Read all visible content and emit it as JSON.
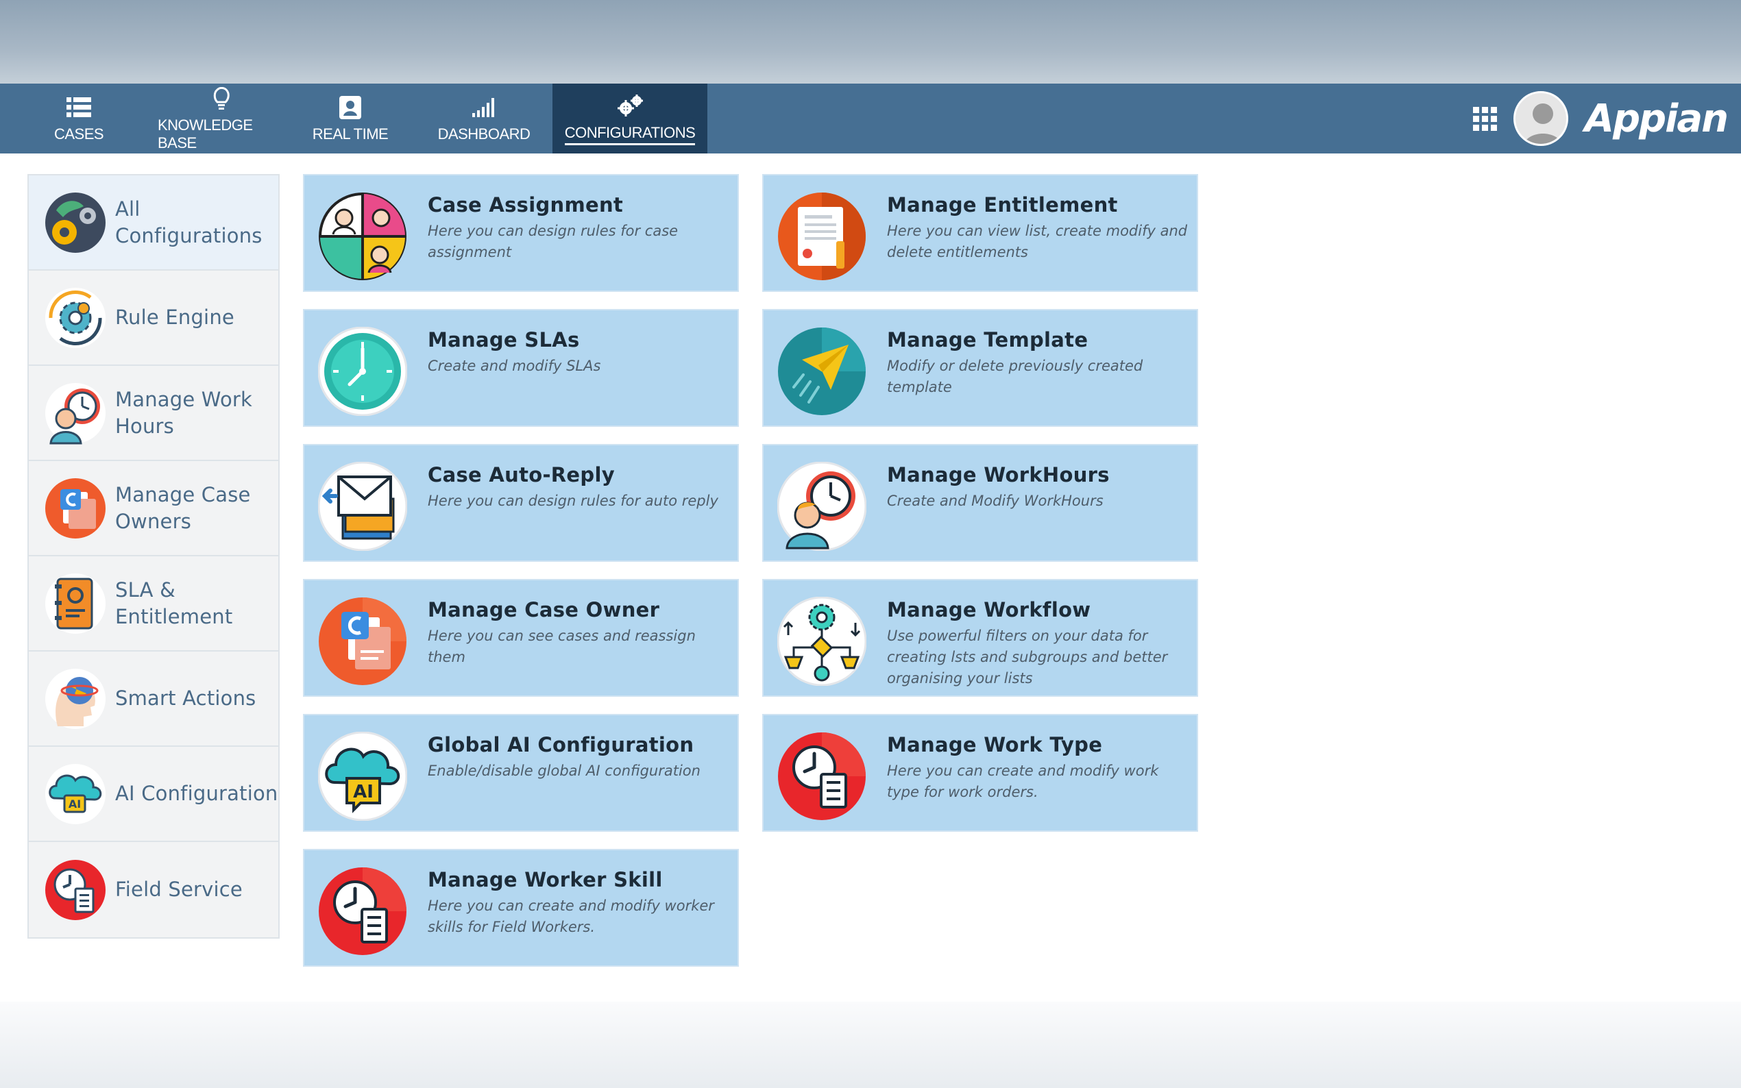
{
  "nav": {
    "tabs": [
      {
        "label": "CASES",
        "icon": "list-icon"
      },
      {
        "label": "KNOWLEDGE BASE",
        "icon": "lightbulb-icon"
      },
      {
        "label": "REAL TIME",
        "icon": "contact-card-icon"
      },
      {
        "label": "DASHBOARD",
        "icon": "signal-bars-icon"
      },
      {
        "label": "CONFIGURATIONS",
        "icon": "gears-icon",
        "active": true
      }
    ],
    "brand": "Appian",
    "accent_color": "#466f93",
    "active_tab_color": "#1f3f5d"
  },
  "sidebar": {
    "items": [
      {
        "label": "All Configurations",
        "icon": "gears-globe-icon"
      },
      {
        "label": "Rule Engine",
        "icon": "gear-cycle-icon"
      },
      {
        "label": "Manage Work Hours",
        "icon": "person-clock-icon"
      },
      {
        "label": "Manage Case Owners",
        "icon": "case-document-icon"
      },
      {
        "label": "SLA & Entitlement",
        "icon": "contact-book-icon"
      },
      {
        "label": "Smart Actions",
        "icon": "head-globe-icon"
      },
      {
        "label": "AI Configuration",
        "icon": "ai-cloud-icon"
      },
      {
        "label": "Field Service",
        "icon": "clock-checklist-icon"
      }
    ]
  },
  "cards": [
    {
      "title": "Case Assignment",
      "desc": "Here you can design rules for case assignment",
      "icon": "people-assignment-icon"
    },
    {
      "title": "Manage Entitlement",
      "desc": "Here you can view list, create modify and delete entitlements",
      "icon": "certificate-document-icon"
    },
    {
      "title": "Manage SLAs",
      "desc": "Create and modify SLAs",
      "icon": "clock-icon"
    },
    {
      "title": "Manage Template",
      "desc": "Modify or delete previously created template",
      "icon": "paper-plane-icon"
    },
    {
      "title": "Case Auto-Reply",
      "desc": "Here you can design rules for auto reply",
      "icon": "envelope-reply-icon"
    },
    {
      "title": "Manage WorkHours",
      "desc": "Create and Modify WorkHours",
      "icon": "person-clock-icon"
    },
    {
      "title": "Manage Case Owner",
      "desc": "Here you can see cases and reassign them",
      "icon": "case-document-icon"
    },
    {
      "title": "Manage Workflow",
      "desc": "Use powerful filters on your data for creating lsts and subgroups and better organising your lists",
      "icon": "workflow-gear-icon"
    },
    {
      "title": "Global AI Configuration",
      "desc": "Enable/disable global AI configuration",
      "icon": "ai-cloud-icon"
    },
    {
      "title": "Manage Work Type",
      "desc": "Here you can create and modify work type for work orders.",
      "icon": "clock-checklist-icon"
    },
    {
      "title": "Manage Worker Skill",
      "desc": "Here you can create and modify worker skills for Field Workers.",
      "icon": "clock-checklist-icon"
    }
  ]
}
